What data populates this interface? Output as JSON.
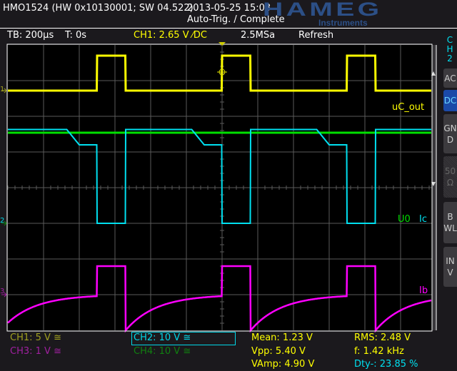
{
  "header": {
    "device": "HMO1524 (HW 0x10130001; SW 04.522)",
    "datetime": "2013-05-25 15:03",
    "trigger_status": "Auto-Trig. / Complete",
    "logo": "HAMEG",
    "logo_sub": "Instruments"
  },
  "status": {
    "timebase": "TB: 200µs",
    "time_offset": "T: 0s",
    "trigger": "CH1: 2.65 V ⁄DC",
    "sample_rate": "2.5MSa",
    "mode": "Refresh"
  },
  "side_menu": {
    "channel": "CH2",
    "items": [
      {
        "label": "AC",
        "state": "off"
      },
      {
        "label": "DC",
        "state": "on"
      },
      {
        "label": "GND",
        "state": "off"
      },
      {
        "label": "50Ω",
        "state": "disabled"
      },
      {
        "label": "BWL",
        "state": "off"
      },
      {
        "label": "INV",
        "state": "off"
      }
    ]
  },
  "trace_labels": {
    "ch1": "uC_out",
    "ch4": "U0",
    "ch2": "Ic",
    "ch3": "Ib",
    "marker1": "1",
    "marker2": "2",
    "marker3": "3"
  },
  "channels": [
    {
      "label": "CH1: 5 V ≅",
      "color": "#a0a020"
    },
    {
      "label": "CH2: 10 V ≅",
      "color": "#00d8e8",
      "selected": true
    },
    {
      "label": "CH3: 1 V ≅",
      "color": "#a020a0"
    },
    {
      "label": "CH4: 10 V ≅",
      "color": "#108010"
    }
  ],
  "measurements": {
    "mean": "Mean: 1.23 V",
    "vpp": "Vpp: 5.40 V",
    "vamp": "VAmp: 4.90 V",
    "rms": "RMS: 2.48 V",
    "freq": "f: 1.42 kHz",
    "duty": "Dty-: 23.85 %"
  },
  "colors": {
    "ch1": "#ffff00",
    "ch2": "#00e0f0",
    "ch3": "#ff00ff",
    "ch4": "#00e000",
    "grid": "#5a5a5a"
  },
  "waveform": {
    "time_per_div_us": 200,
    "period_us": 700,
    "rise_times_us": [
      -700,
      0,
      700
    ],
    "high_duration_us": 160,
    "ch1": {
      "volts_per_div": 5,
      "low_v": 0,
      "high_v": 4.9
    },
    "ch2": {
      "volts_per_div": 10,
      "high_v": 26.3,
      "pre_step_v": 22,
      "low_v": 0
    },
    "ch4": {
      "volts_per_div": 10,
      "level_v": 25.4
    },
    "ch3": {
      "volts_per_div": 1,
      "high_v": 0.8,
      "min_v": -1,
      "settle_v": 0
    }
  }
}
